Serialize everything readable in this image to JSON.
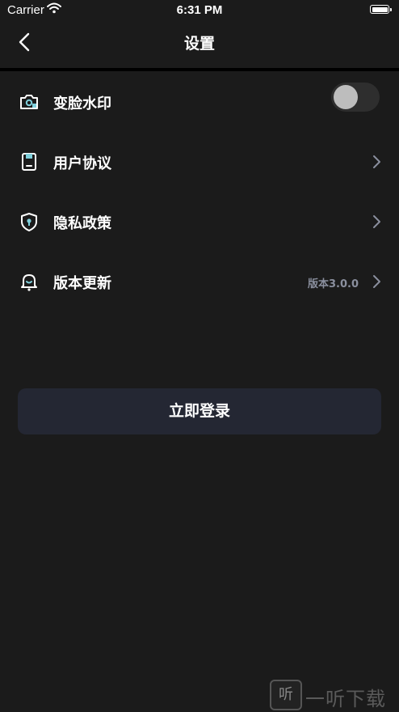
{
  "status_bar": {
    "carrier": "Carrier",
    "time": "6:31 PM"
  },
  "nav": {
    "title": "设置"
  },
  "settings": {
    "items": [
      {
        "label": "变脸水印",
        "icon": "camera-icon",
        "control": "toggle",
        "toggle_on": false
      },
      {
        "label": "用户协议",
        "icon": "phone-document-icon",
        "control": "chevron"
      },
      {
        "label": "隐私政策",
        "icon": "shield-lock-icon",
        "control": "chevron"
      },
      {
        "label": "版本更新",
        "icon": "bell-icon",
        "control": "chevron",
        "value": "版本3.0.0"
      }
    ]
  },
  "login": {
    "label": "立即登录"
  },
  "watermark": {
    "logo_text": "听",
    "text": "一听下载"
  },
  "colors": {
    "background": "#1b1b1b",
    "button_bg": "#242733",
    "icon_accent": "#7fd0dc",
    "muted_text": "#8a8f9e"
  }
}
